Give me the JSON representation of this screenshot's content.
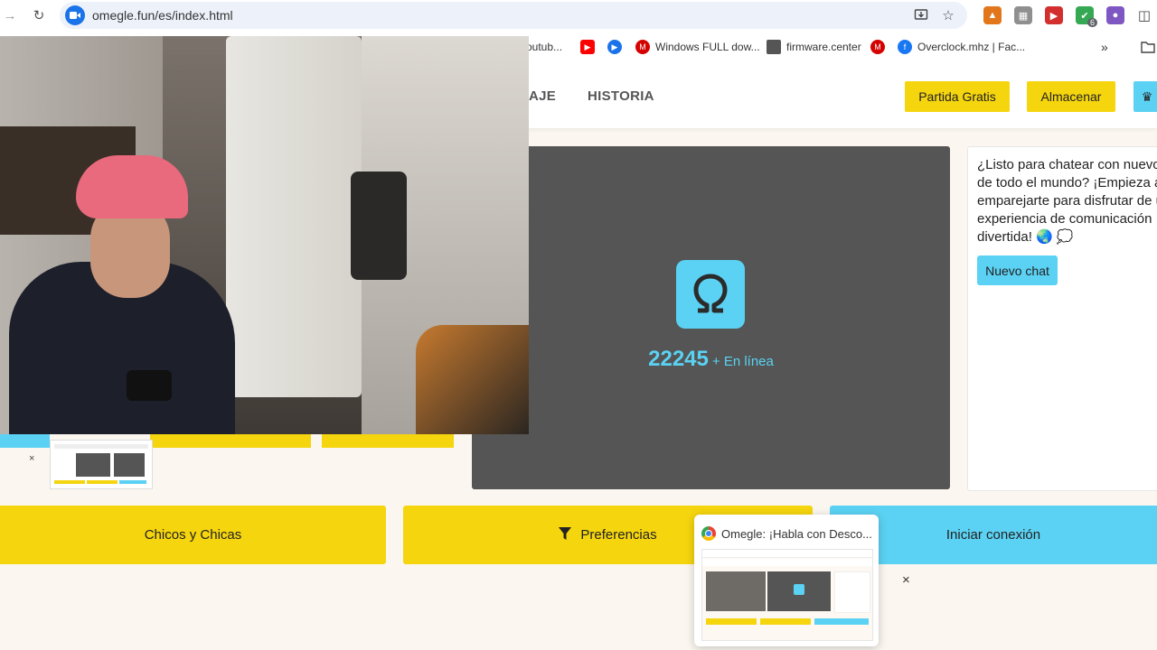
{
  "browser": {
    "url": "omegle.fun/es/index.html",
    "extension_badge": "6"
  },
  "bookmarks": [
    {
      "label": "outub...",
      "icon": "youtube-icon"
    },
    {
      "label": "",
      "icon": "youtube-icon"
    },
    {
      "label": "",
      "icon": "play-icon"
    },
    {
      "label": "Windows FULL dow...",
      "icon": "mega-icon"
    },
    {
      "label": "firmware.center",
      "icon": "folder-icon"
    },
    {
      "label": "",
      "icon": "mega-icon"
    },
    {
      "label": "Overclock.mhz | Fac...",
      "icon": "facebook-icon"
    }
  ],
  "site_nav": {
    "partial_link": "AJE",
    "history_link": "HISTORIA",
    "free_match_button": "Partida Gratis",
    "store_button": "Almacenar"
  },
  "stranger_panel": {
    "online_count": "22245",
    "online_suffix": "+ En línea"
  },
  "chat_panel": {
    "message_lines": [
      "¿Listo para chatear con nuevos",
      "de todo el mundo? ¡Empieza a",
      "emparejarte para disfrutar de una",
      "experiencia de comunicación",
      "divertida! 🌏 💭"
    ],
    "new_chat_button": "Nuevo chat"
  },
  "controls": {
    "gender_button": "Chicos y Chicas",
    "preferences_button": "Preferencias",
    "connect_button": "Iniciar conexión"
  },
  "tab_preview": {
    "title": "Omegle: ¡Habla con Desco...",
    "close": "×"
  },
  "mini_close": "×",
  "colors": {
    "yellow": "#f5d50e",
    "cyan": "#5bd2f3",
    "dark_video": "#545554",
    "page_bg": "#fbf7f0"
  }
}
